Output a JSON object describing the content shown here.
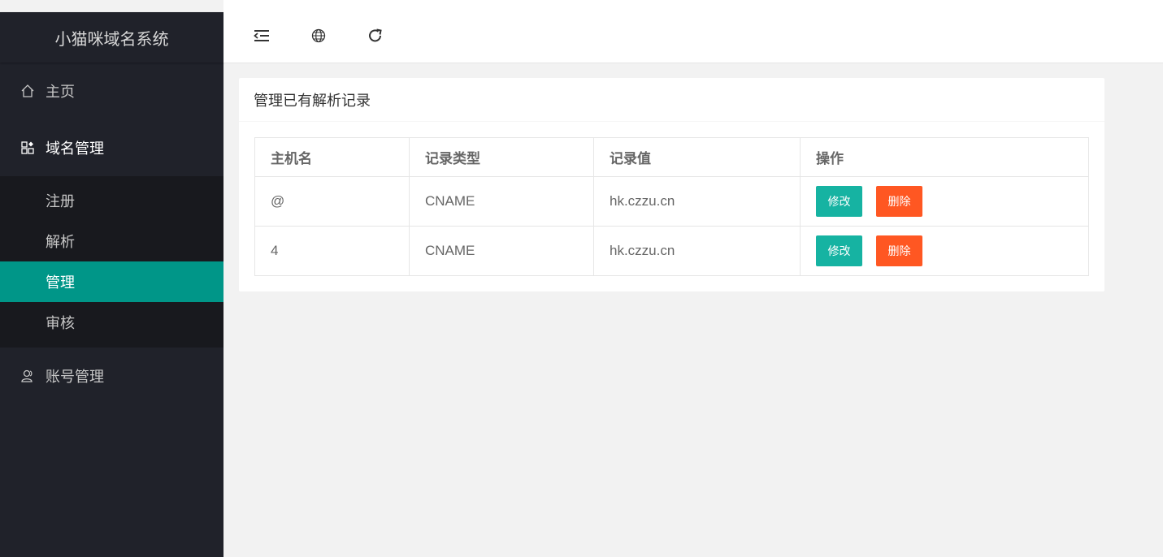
{
  "app": {
    "title": "小猫咪域名系统"
  },
  "sidebar": {
    "items": [
      {
        "label": "主页",
        "icon": "home-icon"
      },
      {
        "label": "域名管理",
        "icon": "apps-icon"
      },
      {
        "label": "账号管理",
        "icon": "user-icon"
      }
    ],
    "submenu": [
      {
        "label": "注册"
      },
      {
        "label": "解析"
      },
      {
        "label": "管理"
      },
      {
        "label": "审核"
      }
    ]
  },
  "topbar": {
    "icons": [
      "menu-collapse-icon",
      "globe-icon",
      "refresh-icon"
    ]
  },
  "main": {
    "card_title": "管理已有解析记录",
    "table": {
      "headers": [
        "主机名",
        "记录类型",
        "记录值",
        "操作"
      ],
      "rows": [
        {
          "host": "@",
          "type": "CNAME",
          "value": "hk.czzu.cn",
          "edit_label": "修改",
          "delete_label": "删除"
        },
        {
          "host": "4",
          "type": "CNAME",
          "value": "hk.czzu.cn",
          "edit_label": "修改",
          "delete_label": "删除"
        }
      ]
    }
  },
  "colors": {
    "sidebar_bg": "#20222a",
    "submenu_bg": "#18191e",
    "accent": "#009688",
    "edit_button": "#16b3a2",
    "delete_button": "#ff5722"
  }
}
